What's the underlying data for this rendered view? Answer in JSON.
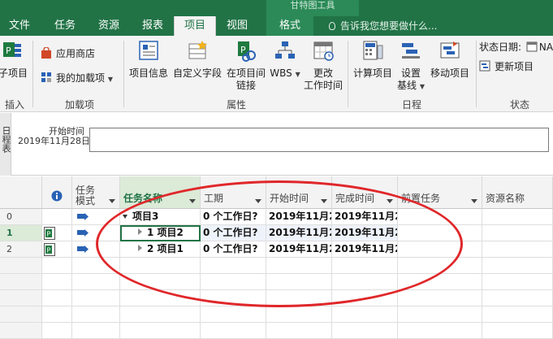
{
  "titlebar": {
    "context_title": "甘特图工具"
  },
  "tabs": [
    {
      "label": "文件",
      "state": "normal"
    },
    {
      "label": "任务",
      "state": "normal"
    },
    {
      "label": "资源",
      "state": "normal"
    },
    {
      "label": "报表",
      "state": "normal"
    },
    {
      "label": "项目",
      "state": "active"
    },
    {
      "label": "视图",
      "state": "normal"
    },
    {
      "label": "格式",
      "state": "context"
    }
  ],
  "tellme": "告诉我您想要做什么...",
  "ribbon": {
    "insert": {
      "button": "子项目",
      "group": "插入"
    },
    "addins": {
      "store": "应用商店",
      "my_addins": "我的加载项",
      "group": "加载项"
    },
    "properties": {
      "project_info": "项目信息",
      "custom_fields": "自定义字段",
      "links_line1": "在项目间",
      "links_line2": "链接",
      "wbs": "WBS",
      "change_time_line1": "更改",
      "change_time_line2": "工作时间",
      "group": "属性"
    },
    "schedule": {
      "calc": "计算项目",
      "baseline_line1": "设置",
      "baseline_line2": "基线",
      "move": "移动项目",
      "group": "日程"
    },
    "status": {
      "status_date": "状态日期:",
      "status_value": "NA",
      "update": "更新项目",
      "group": "状态"
    }
  },
  "timeline": {
    "side_label": "日程表",
    "start_label": "开始时间",
    "start_date": "2019年11月28日"
  },
  "grid": {
    "headers": {
      "task_mode": "任务\n模式",
      "task_name": "任务名称",
      "duration": "工期",
      "start": "开始时间",
      "finish": "完成时间",
      "predecessors": "前置任务",
      "resources": "资源名称"
    },
    "rows": [
      {
        "num": "0",
        "name": "项目3",
        "duration": "0 个工作日?",
        "start": "2019年11月2",
        "finish": "2019年11月2"
      },
      {
        "num": "1",
        "name": "1 项目2",
        "duration": "0 个工作日?",
        "start": "2019年11月2",
        "finish": "2019年11月2"
      },
      {
        "num": "2",
        "name": "2 项目1",
        "duration": "0 个工作日?",
        "start": "2019年11月2",
        "finish": "2019年11月2"
      }
    ]
  },
  "colors": {
    "brand": "#217346",
    "annotation": "#e0272a"
  }
}
